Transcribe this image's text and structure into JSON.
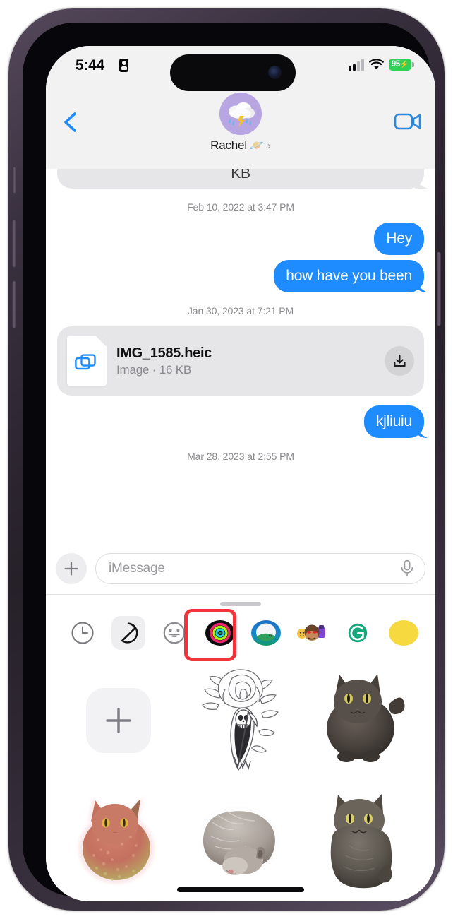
{
  "device": {
    "name": "iPhone 14 Pro",
    "frame_color": "#3a3140"
  },
  "status_bar": {
    "time": "5:44",
    "recording_icon": "id-card-icon",
    "signal_icon": "cellular-signal-icon",
    "wifi_icon": "wifi-icon",
    "battery_percent": "95",
    "battery_charging_icon": "lightning-bolt-icon",
    "battery_color": "#31d158"
  },
  "header": {
    "back_icon": "chevron-left-icon",
    "facetime_icon": "video-camera-icon",
    "avatar_icon": "thunderstorm-emoji-avatar",
    "avatar_bg": "#b8a6e3",
    "contact_name": "Rachel",
    "contact_emoji": "🪐",
    "contact_chevron": "›"
  },
  "conversation": {
    "partial_bubble_text": "KB",
    "items": [
      {
        "kind": "timestamp",
        "text": "Feb 10, 2022 at 3:47 PM"
      },
      {
        "kind": "message",
        "side": "out",
        "text": "Hey"
      },
      {
        "kind": "message",
        "side": "out",
        "text": "how have you been"
      },
      {
        "kind": "timestamp",
        "text": "Jan 30, 2023 at 7:21 PM"
      },
      {
        "kind": "attachment",
        "side": "in"
      },
      {
        "kind": "message",
        "side": "out",
        "text": "kjliuiu"
      },
      {
        "kind": "timestamp",
        "text": "Mar 28, 2023 at 2:55 PM"
      }
    ],
    "attachment": {
      "file_name": "IMG_1585.heic",
      "file_meta": "Image · 16 KB",
      "file_type_icon": "image-file-icon",
      "download_icon": "download-icon"
    }
  },
  "compose": {
    "plus_icon": "plus-icon",
    "plus_label": "+",
    "placeholder": "iMessage",
    "value": "",
    "mic_icon": "microphone-icon"
  },
  "app_drawer": {
    "grabber_label": "drag-handle",
    "highlight_color": "#f4323c",
    "highlighted_app": "emoji-stickers-app",
    "apps": [
      {
        "id": "recents-app",
        "icon": "clock-icon",
        "label": "Recents"
      },
      {
        "id": "digital-touch-app",
        "icon": "folded-circle-icon",
        "label": "Digital Touch"
      },
      {
        "id": "emoji-stickers-app",
        "icon": "smiley-face-icon",
        "label": "Stickers",
        "highlighted": true
      },
      {
        "id": "fitness-app",
        "icon": "activity-rings-icon",
        "label": "Fitness"
      },
      {
        "id": "photos-app",
        "icon": "landscape-icon",
        "label": "Photos"
      },
      {
        "id": "memoji-app",
        "icon": "memoji-stickers-icon",
        "label": "Memoji"
      },
      {
        "id": "grammarly-app",
        "icon": "grammarly-g-icon",
        "label": "Grammarly"
      },
      {
        "id": "partial-app",
        "icon": "yellow-app-icon",
        "label": ""
      }
    ],
    "add_sticker_label": "+",
    "add_sticker_icon": "plus-icon",
    "stickers": [
      {
        "id": "add-sticker",
        "type": "add-button",
        "label": "Add Sticker"
      },
      {
        "id": "tattoo-sticker",
        "type": "line-art",
        "label": "Flower and reaper tattoo line art sticker"
      },
      {
        "id": "cat-sticker-1",
        "type": "cat",
        "label": "Dark fluffy cat standing sticker"
      },
      {
        "id": "cat-sticker-2",
        "type": "cat-pink",
        "label": "Pink glitter cat sticker"
      },
      {
        "id": "cat-sticker-3",
        "type": "cat-curled",
        "label": "Gray cat curled up sticker"
      },
      {
        "id": "cat-sticker-4",
        "type": "cat-sitting",
        "label": "Dark gray cat sitting sticker"
      }
    ]
  },
  "home_indicator": "home-indicator-bar"
}
